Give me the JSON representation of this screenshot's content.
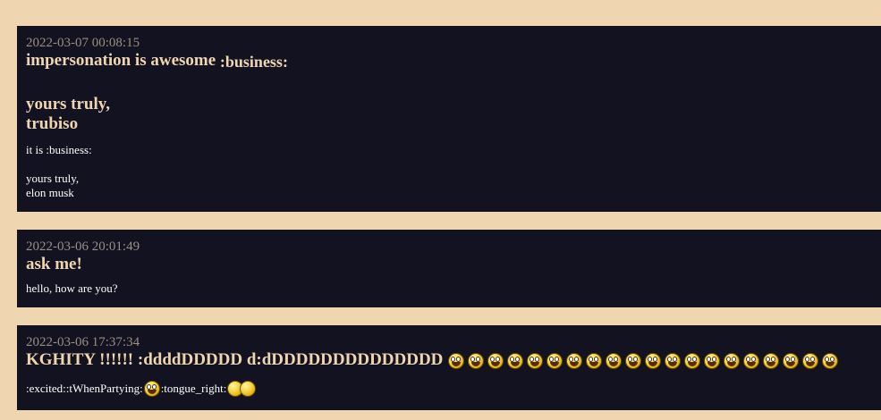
{
  "posts": [
    {
      "timestamp": "2022-03-07 00:08:15",
      "subject": "impersonation is awesome",
      "subject_suffix": ":business:",
      "subject_line2": "yours truly,",
      "subject_line3": "trubiso",
      "body_line1": "it is :business:",
      "body_line2": "yours truly,",
      "body_line3": "elon musk"
    },
    {
      "timestamp": "2022-03-06 20:01:49",
      "subject": "ask me!",
      "body_line1": "hello, how are you?"
    },
    {
      "timestamp": "2022-03-06 17:37:34",
      "subject": "KGHITY !!!!!! :ddddDDDDD d:dDDDDDDDDDDDDDD",
      "subject_emoji_count": 20,
      "subject_emoji_name": "grinning-smiley-icon",
      "body_part1": ":excited::tWhenPartying:",
      "body_emoji1_name": "excited-smiley-icon",
      "body_part2": ":tongue_right:",
      "body_emoji2_name": "kissing-smileys-icon"
    }
  ]
}
